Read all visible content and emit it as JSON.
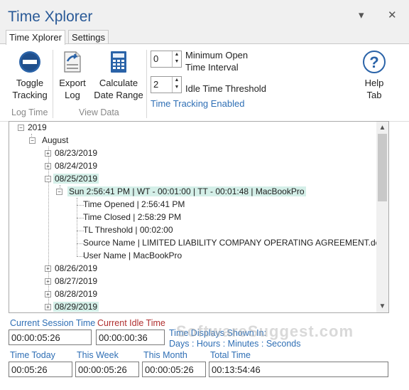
{
  "app": {
    "title": "Time Xplorer",
    "close_glyph": "✕",
    "menu_glyph": "▾"
  },
  "tabs": [
    {
      "label": "Time Xplorer",
      "active": true
    },
    {
      "label": "Settings",
      "active": false
    }
  ],
  "ribbon": {
    "toggle": {
      "line1": "Toggle",
      "line2": "Tracking",
      "icon": "no-entry-icon"
    },
    "export": {
      "line1": "Export",
      "line2": "Log",
      "icon": "export-document-icon"
    },
    "calc": {
      "line1": "Calculate",
      "line2": "Date Range",
      "icon": "calculator-icon"
    },
    "help": {
      "line1": "Help",
      "line2": "Tab",
      "icon": "help-icon"
    },
    "group_log": "Log Time",
    "group_view": "View Data",
    "min_open_value": "0",
    "min_open_label1": "Minimum Open",
    "min_open_label2": "Time Interval",
    "idle_value": "2",
    "idle_label": "Idle Time Threshold",
    "status": "Time Tracking Enabled"
  },
  "tree": {
    "year": "2019",
    "month": "August",
    "dates_before": [
      "08/23/2019",
      "08/24/2019"
    ],
    "open_date": "08/25/2019",
    "session": "Sun 2:56:41 PM | WT - 00:01:00 | TT - 00:01:48 | MacBookPro",
    "details": [
      "Time Opened | 2:56:41 PM",
      "Time Closed | 2:58:29 PM",
      "TL Threshold | 00:02:00",
      "Source Name | LIMITED LIABILITY COMPANY OPERATING AGREEMENT.doc",
      "User Name | MacBookPro"
    ],
    "dates_after": [
      "08/26/2019",
      "08/27/2019",
      "08/28/2019",
      "08/29/2019"
    ]
  },
  "fields": {
    "session_label": "Current Session Time",
    "session_value": "00:00:05:26",
    "idle_label": "Current Idle Time",
    "idle_value": "00:00:00:36",
    "hint1": "Time Displays Shown In:",
    "hint2": "Days : Hours : Minutes : Seconds",
    "today_label": "Time Today",
    "today_value": "00:05:26",
    "week_label": "This Week",
    "week_value": "00:00:05:26",
    "month_label": "This Month",
    "month_value": "00:00:05:26",
    "total_label": "Total Time",
    "total_value": "00:13:54:46"
  },
  "watermark": "SoftwareSuggest.com",
  "colors": {
    "title": "#2a5a97",
    "link": "#2f6fb5",
    "idle_label": "#b03030",
    "highlight": "#d4efe8"
  }
}
